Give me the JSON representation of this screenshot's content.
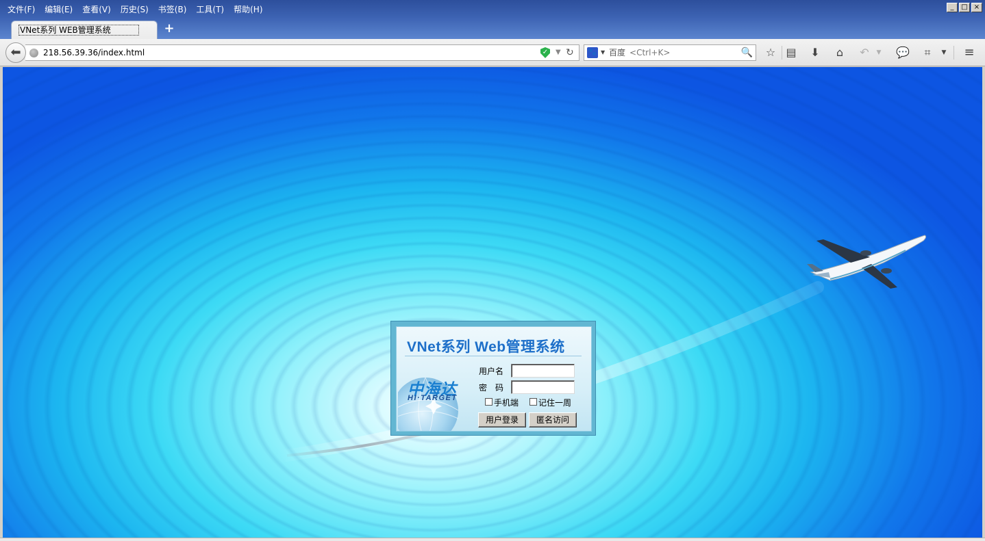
{
  "menu": [
    "文件(F)",
    "编辑(E)",
    "查看(V)",
    "历史(S)",
    "书签(B)",
    "工具(T)",
    "帮助(H)"
  ],
  "window_controls": {
    "minimize": "_",
    "maximize": "□",
    "close": "×"
  },
  "tab": {
    "title": "VNet系列 WEB管理系统",
    "new_tab": "+"
  },
  "url": "218.56.39.36/index.html",
  "search": {
    "engine": "百度",
    "placeholder": "<Ctrl+K>"
  },
  "icons": {
    "back": "back-arrow-icon",
    "bookmark": "star-icon",
    "reading_list": "clipboard-icon",
    "download": "download-icon",
    "home": "home-icon",
    "undo": "undo-icon",
    "chat": "chat-icon",
    "screenshot": "crop-icon",
    "menu": "hamburger-icon"
  },
  "login": {
    "title": "VNet系列 Web管理系统",
    "brand_cn": "中海达",
    "brand_en": "HI·TARGET",
    "username_label": "用户名",
    "password_label": "密　码",
    "mobile_label": "手机端",
    "remember_label": "记住一周",
    "login_button": "用户登录",
    "anonymous_button": "匿名访问"
  },
  "colors": {
    "title_blue": "#1d6fc9",
    "frame_blue": "#62b6d2",
    "sky_deep": "#0d55e2",
    "sky_light": "#8cf0fb"
  }
}
